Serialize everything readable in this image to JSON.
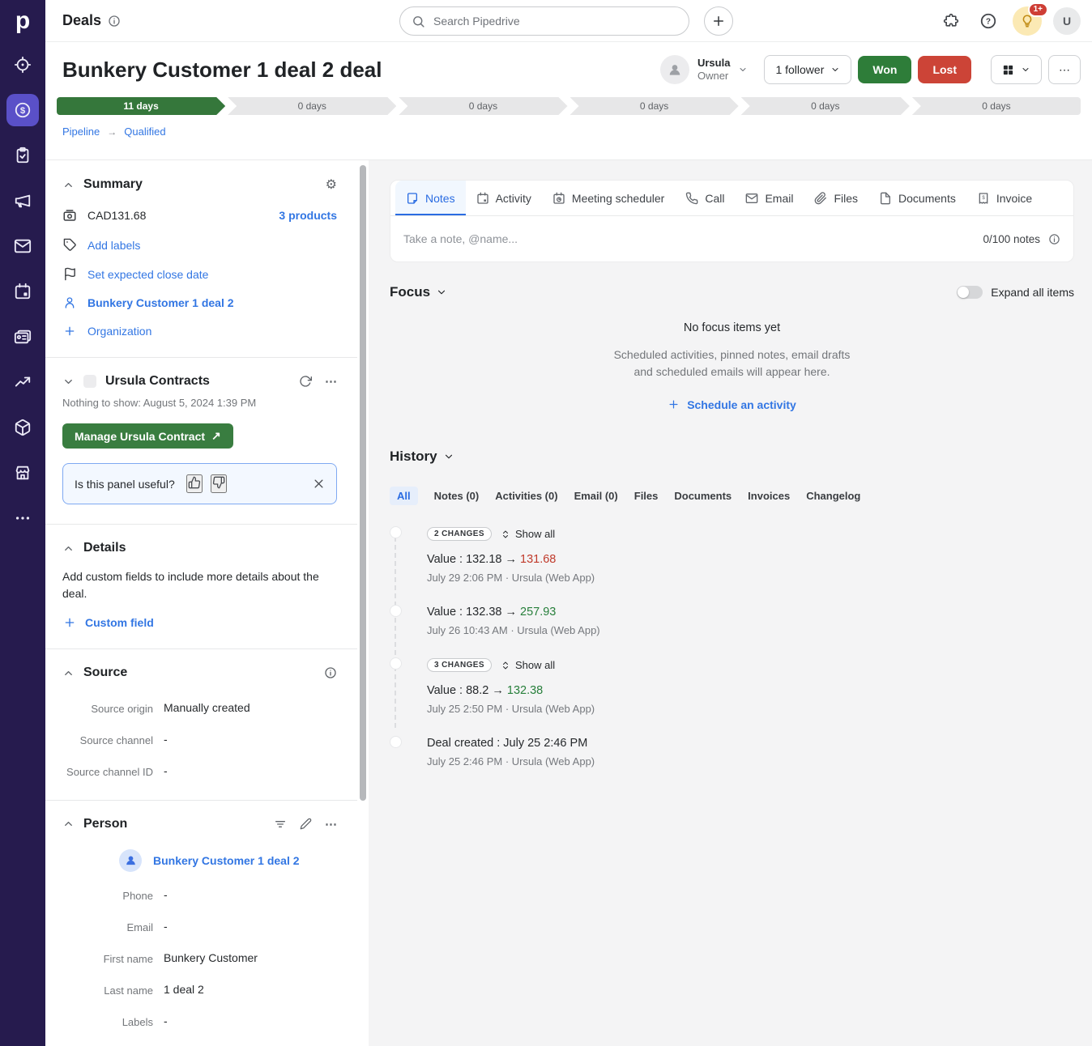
{
  "topbar": {
    "app_title": "Deals",
    "search_placeholder": "Search Pipedrive",
    "notification_badge": "1+",
    "avatar_initial": "U"
  },
  "sidebar_nav": {
    "active_item": "deals",
    "items": [
      {
        "name": "leads"
      },
      {
        "name": "deals"
      },
      {
        "name": "projects"
      },
      {
        "name": "campaigns"
      },
      {
        "name": "mail"
      },
      {
        "name": "activities"
      },
      {
        "name": "contacts"
      },
      {
        "name": "insights"
      },
      {
        "name": "products"
      },
      {
        "name": "marketplace"
      },
      {
        "name": "more"
      }
    ]
  },
  "header": {
    "deal_title": "Bunkery Customer 1 deal 2 deal",
    "owner_name": "Ursula",
    "owner_role": "Owner",
    "followers_label": "1 follower",
    "won_label": "Won",
    "lost_label": "Lost"
  },
  "stagebar": {
    "stages": [
      {
        "label": "11 days",
        "active": true
      },
      {
        "label": "0 days"
      },
      {
        "label": "0 days"
      },
      {
        "label": "0 days"
      },
      {
        "label": "0 days"
      },
      {
        "label": "0 days"
      }
    ]
  },
  "breadcrumb": {
    "pipeline": "Pipeline",
    "stage": "Qualified"
  },
  "summary": {
    "title": "Summary",
    "value": "CAD131.68",
    "products_link": "3 products",
    "add_labels": "Add labels",
    "set_close_date": "Set expected close date",
    "person_link": "Bunkery Customer 1 deal 2",
    "organization_link": "Organization"
  },
  "contracts_panel": {
    "title": "Ursula Contracts",
    "status": "Nothing to show: August 5, 2024 1:39 PM",
    "manage_button": "Manage Ursula Contract",
    "feedback_question": "Is this panel useful?"
  },
  "details": {
    "title": "Details",
    "description": "Add custom fields to include more details about the deal.",
    "custom_field_link": "Custom field"
  },
  "source": {
    "title": "Source",
    "rows": [
      {
        "label": "Source origin",
        "value": "Manually created"
      },
      {
        "label": "Source channel",
        "value": "-"
      },
      {
        "label": "Source channel ID",
        "value": "-"
      }
    ]
  },
  "person": {
    "title": "Person",
    "name": "Bunkery Customer 1 deal 2",
    "rows": [
      {
        "label": "Phone",
        "value": "-"
      },
      {
        "label": "Email",
        "value": "-"
      },
      {
        "label": "First name",
        "value": "Bunkery Customer"
      },
      {
        "label": "Last name",
        "value": "1 deal 2"
      },
      {
        "label": "Labels",
        "value": "-"
      }
    ]
  },
  "tabs": {
    "items": [
      {
        "label": "Notes",
        "active": true
      },
      {
        "label": "Activity"
      },
      {
        "label": "Meeting scheduler"
      },
      {
        "label": "Call"
      },
      {
        "label": "Email"
      },
      {
        "label": "Files"
      },
      {
        "label": "Documents"
      },
      {
        "label": "Invoice"
      }
    ]
  },
  "note_input": {
    "placeholder": "Take a note, @name...",
    "counter": "0/100 notes"
  },
  "focus": {
    "title": "Focus",
    "expand_toggle_label": "Expand all items",
    "empty_title": "No focus items yet",
    "empty_line1": "Scheduled activities, pinned notes, email drafts",
    "empty_line2": "and scheduled emails will appear here.",
    "schedule_cta": "Schedule an activity"
  },
  "history": {
    "title": "History",
    "filters": [
      {
        "label": "All",
        "active": true
      },
      {
        "label": "Notes (0)"
      },
      {
        "label": "Activities (0)"
      },
      {
        "label": "Email (0)"
      },
      {
        "label": "Files"
      },
      {
        "label": "Documents"
      },
      {
        "label": "Invoices"
      },
      {
        "label": "Changelog"
      }
    ],
    "entries": [
      {
        "badge": "2 CHANGES",
        "show_all": "Show all",
        "change_text": "Value : 132.18 →",
        "change_new": "131.68",
        "direction": "decrease",
        "meta": "July 29 2:06 PM · Ursula (Web App)"
      },
      {
        "change_text": "Value : 132.38 →",
        "change_new": "257.93",
        "direction": "increase",
        "meta": "July 26 10:43 AM · Ursula (Web App)"
      },
      {
        "badge": "3 CHANGES",
        "show_all": "Show all",
        "change_text": "Value : 88.2 →",
        "change_new": "132.38",
        "direction": "increase",
        "meta": "July 25 2:50 PM · Ursula (Web App)"
      },
      {
        "event_text": "Deal created : July 25 2:46 PM",
        "meta": "July 25 2:46 PM · Ursula (Web App)"
      }
    ]
  },
  "colors": {
    "nav_rail": "#261b4e",
    "nav_active": "#5a50c8",
    "link_blue": "#3276e3",
    "won_green": "#2e7d39",
    "lost_red": "#cc4437",
    "contract_green": "#397d40",
    "stage_green": "#35773b",
    "value_increase": "#277f3b",
    "value_decrease": "#c03a2b",
    "active_tab_blue": "#2a6ce2",
    "feedback_border": "#7fa9f2",
    "bulb_bg": "#fbe9b4",
    "badge_red": "#ce3e35"
  }
}
